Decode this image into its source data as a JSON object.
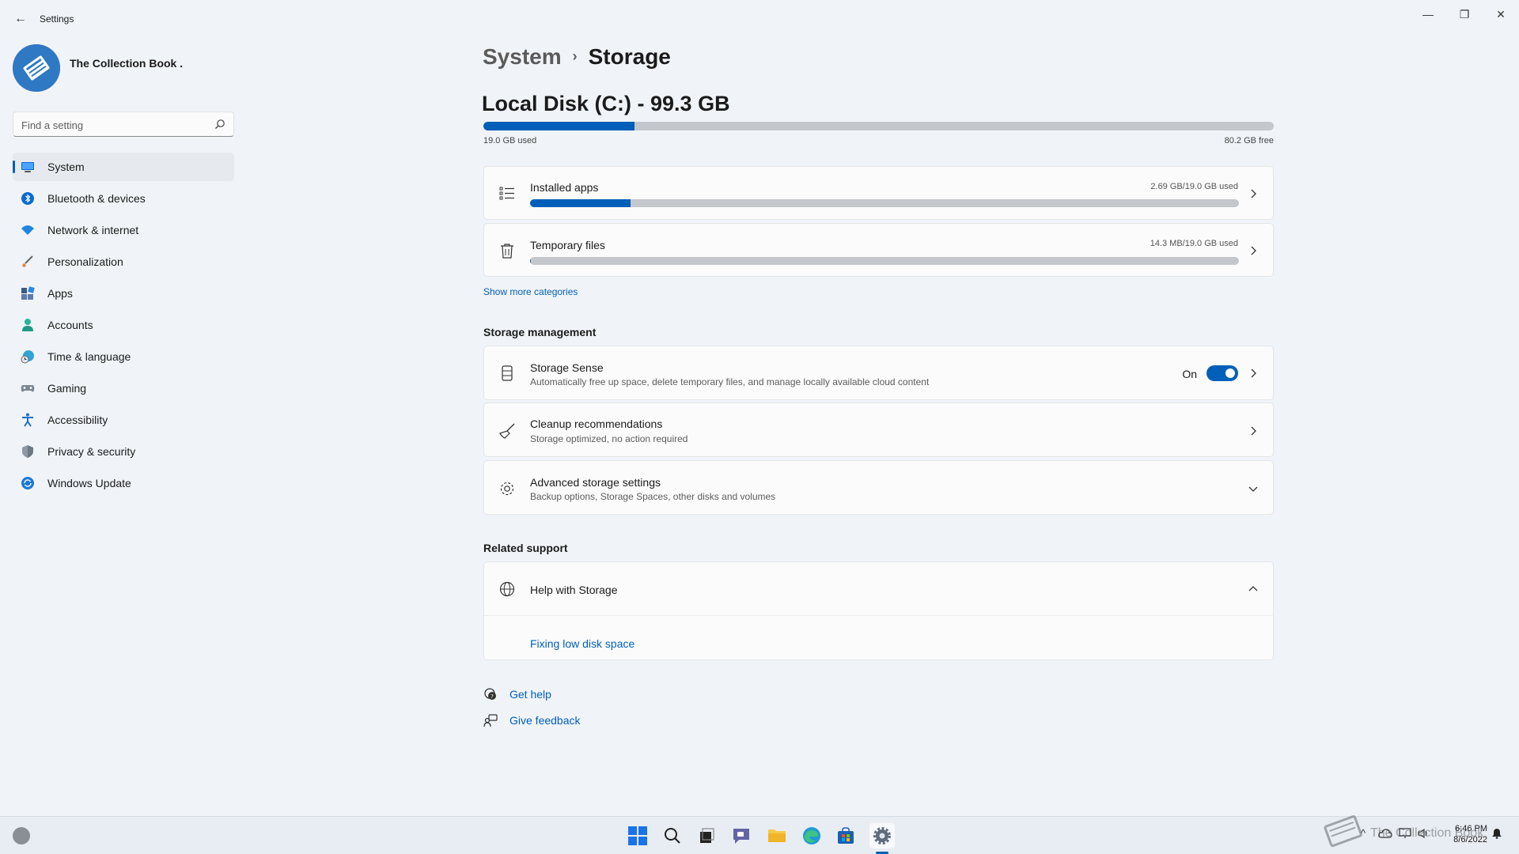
{
  "window": {
    "back_glyph": "←",
    "title": "Settings",
    "min_glyph": "—",
    "max_glyph": "❐",
    "close_glyph": "✕"
  },
  "profile": {
    "name": "The Collection Book ."
  },
  "search": {
    "placeholder": "Find a setting"
  },
  "sidebar": {
    "items": [
      {
        "label": "System",
        "icon": "monitor-icon",
        "active": true
      },
      {
        "label": "Bluetooth & devices",
        "icon": "bluetooth-icon"
      },
      {
        "label": "Network & internet",
        "icon": "wifi-icon"
      },
      {
        "label": "Personalization",
        "icon": "brush-icon"
      },
      {
        "label": "Apps",
        "icon": "apps-icon"
      },
      {
        "label": "Accounts",
        "icon": "person-icon"
      },
      {
        "label": "Time & language",
        "icon": "globe-clock-icon"
      },
      {
        "label": "Gaming",
        "icon": "gamepad-icon"
      },
      {
        "label": "Accessibility",
        "icon": "accessibility-icon"
      },
      {
        "label": "Privacy & security",
        "icon": "shield-icon"
      },
      {
        "label": "Windows Update",
        "icon": "update-icon"
      }
    ]
  },
  "breadcrumb": {
    "parent": "System",
    "separator": "›",
    "current": "Storage"
  },
  "disk": {
    "title": "Local Disk (C:) - 99.3 GB",
    "used_label": "19.0 GB used",
    "free_label": "80.2 GB free",
    "used_fraction": 0.191
  },
  "categories": [
    {
      "title": "Installed apps",
      "usage": "2.69 GB/19.0 GB used",
      "fraction": 0.142,
      "icon": "list-icon"
    },
    {
      "title": "Temporary files",
      "usage": "14.3 MB/19.0 GB used",
      "fraction": 0.001,
      "icon": "trash-icon"
    }
  ],
  "show_more": "Show more categories",
  "storage_management": {
    "heading": "Storage management",
    "sense": {
      "title": "Storage Sense",
      "subtitle": "Automatically free up space, delete temporary files, and manage locally available cloud content",
      "state": "On"
    },
    "cleanup": {
      "title": "Cleanup recommendations",
      "subtitle": "Storage optimized, no action required"
    },
    "advanced": {
      "title": "Advanced storage settings",
      "subtitle": "Backup options, Storage Spaces, other disks and volumes"
    }
  },
  "related_support": {
    "heading": "Related support",
    "help_title": "Help with Storage",
    "help_link": "Fixing low disk space"
  },
  "footer": {
    "get_help": "Get help",
    "give_feedback": "Give feedback"
  },
  "taskbar": {
    "clock_time": "6:46 PM",
    "clock_date": "8/6/2022",
    "watermark": "The Collection Book"
  },
  "colors": {
    "accent": "#005fb8",
    "background": "#f0f4f9",
    "card": "#fbfbfb"
  }
}
